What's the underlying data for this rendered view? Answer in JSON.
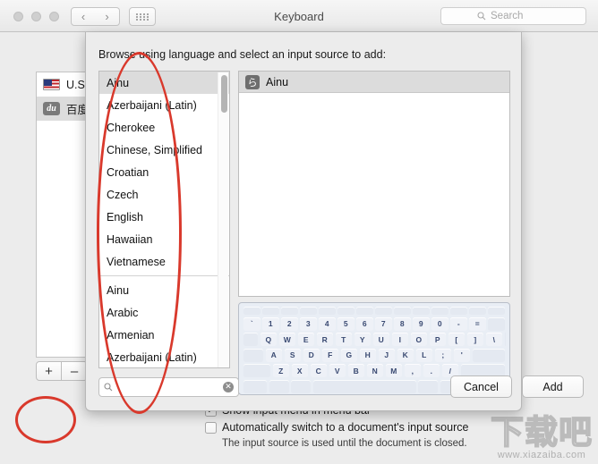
{
  "window": {
    "title": "Keyboard",
    "traffic_lights": [
      "close",
      "minimize",
      "maximize"
    ],
    "nav_back_icon": "‹",
    "nav_forward_icon": "›",
    "grid_icon": "grid-icon",
    "toolbar_search": {
      "icon": "search-icon",
      "placeholder": "Search",
      "value": ""
    }
  },
  "background_pane": {
    "input_sources": [
      {
        "label": "U.S.",
        "icon": "us-flag-icon",
        "selected": false
      },
      {
        "label": "百度",
        "icon": "du-badge-icon",
        "selected": true
      }
    ],
    "add_button_label": "+",
    "remove_button_label": "–",
    "options": [
      {
        "label": "Show input menu in menu bar",
        "checked": true,
        "sublabel": ""
      },
      {
        "label": "Automatically switch to a document's input source",
        "checked": false,
        "sublabel": "The input source is used until the document is closed."
      }
    ]
  },
  "sheet": {
    "prompt": "Browse using language and select an input source to add:",
    "language_groups": [
      {
        "items": [
          "Ainu",
          "Azerbaijani (Latin)",
          "Cherokee",
          "Chinese, Simplified",
          "Croatian",
          "Czech",
          "English",
          "Hawaiian",
          "Vietnamese"
        ]
      },
      {
        "items": [
          "Ainu",
          "Arabic",
          "Armenian",
          "Azerbaijani (Latin)"
        ]
      }
    ],
    "selected_language": "Ainu",
    "source_panel": {
      "header_icon": "ainu-kana-icon",
      "header_label": "Ainu",
      "rows": []
    },
    "keyboard_preview": {
      "rows": [
        [
          "`",
          "1",
          "2",
          "3",
          "4",
          "5",
          "6",
          "7",
          "8",
          "9",
          "0",
          "-",
          "="
        ],
        [
          "Q",
          "W",
          "E",
          "R",
          "T",
          "Y",
          "U",
          "I",
          "O",
          "P",
          "[",
          "]",
          "\\"
        ],
        [
          "A",
          "S",
          "D",
          "F",
          "G",
          "H",
          "J",
          "K",
          "L",
          ";",
          "'"
        ],
        [
          "Z",
          "X",
          "C",
          "V",
          "B",
          "N",
          "M",
          ",",
          ".",
          "/"
        ]
      ]
    },
    "search": {
      "icon": "search-icon",
      "placeholder": "",
      "value": "",
      "clear_icon": "clear-circle-icon"
    },
    "cancel_label": "Cancel",
    "add_label": "Add"
  },
  "annotations": [
    {
      "name": "language-list-highlight",
      "shape": "ellipse",
      "color": "#d9392c"
    },
    {
      "name": "add-button-highlight",
      "shape": "ellipse",
      "color": "#d9392c"
    }
  ],
  "watermark": {
    "main": "下载吧",
    "sub": "www.xiazaiba.com"
  }
}
